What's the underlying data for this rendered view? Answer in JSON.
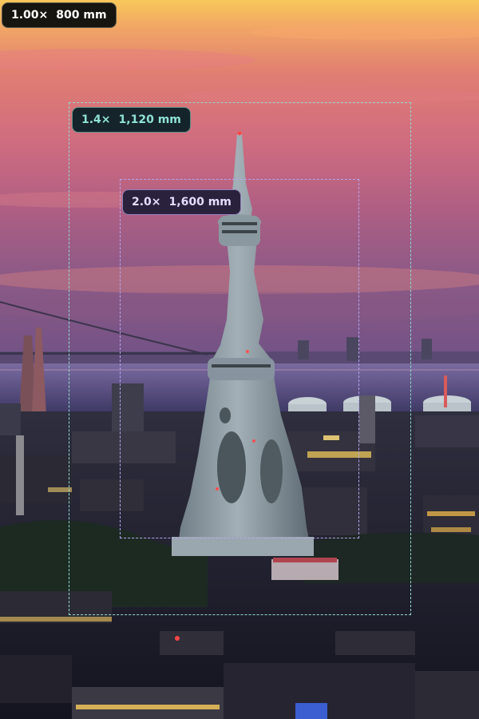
{
  "overlays": [
    {
      "factor": "1.00×",
      "focal_length": "800 mm",
      "accent": "#ffffff"
    },
    {
      "factor": "1.4×",
      "focal_length": "1,120 mm",
      "accent": "#8fd9d0"
    },
    {
      "factor": "2.0×",
      "focal_length": "1,600 mm",
      "accent": "#b7a7f0"
    }
  ],
  "scene": {
    "sky_colors": [
      "#f6c05a",
      "#e98565",
      "#c96a7c",
      "#9a5d7d"
    ],
    "sea_color": "#5b4f80",
    "tower_color": "#8f9ea6"
  }
}
